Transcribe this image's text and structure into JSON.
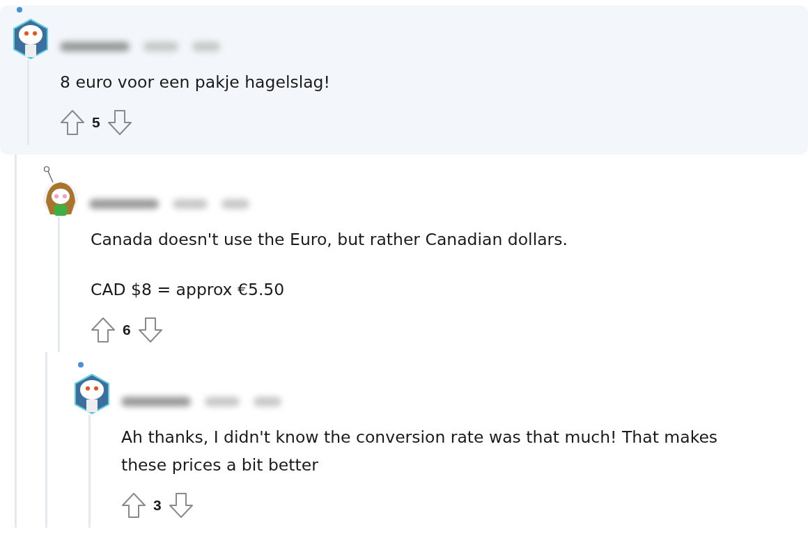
{
  "comments": [
    {
      "kind": "hexagon",
      "highlighted": true,
      "paragraphs": [
        "8 euro voor een pakje hagelslag!"
      ],
      "score": "5",
      "children": [
        {
          "kind": "circle",
          "highlighted": false,
          "paragraphs": [
            "Canada doesn't use the Euro, but rather Canadian dollars.",
            "CAD $8 = approx €5.50"
          ],
          "score": "6",
          "children": [
            {
              "kind": "hexagon",
              "highlighted": false,
              "paragraphs": [
                "Ah thanks, I didn't know the conversion rate was that much! That makes these prices a bit better"
              ],
              "score": "3"
            }
          ]
        }
      ]
    }
  ]
}
